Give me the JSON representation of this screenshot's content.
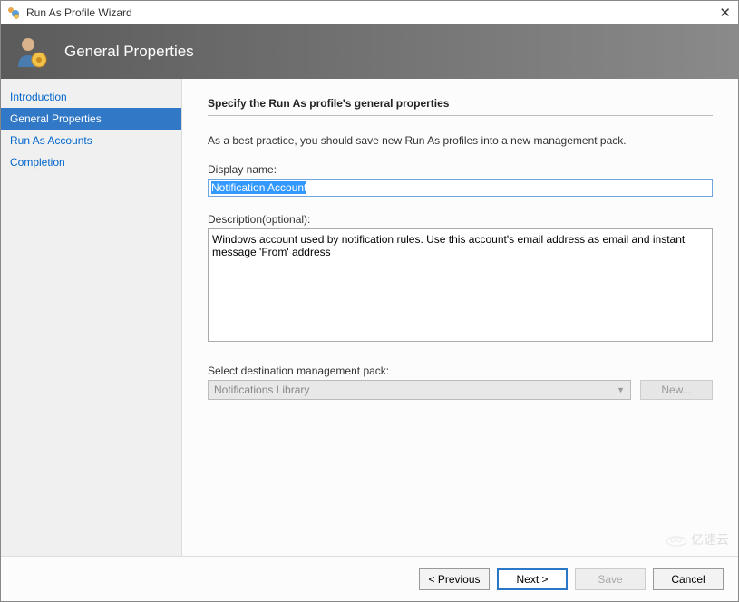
{
  "window": {
    "title": "Run As Profile Wizard"
  },
  "header": {
    "title": "General Properties"
  },
  "sidebar": {
    "items": [
      {
        "label": "Introduction",
        "active": false
      },
      {
        "label": "General Properties",
        "active": true
      },
      {
        "label": "Run As Accounts",
        "active": false
      },
      {
        "label": "Completion",
        "active": false
      }
    ]
  },
  "content": {
    "heading": "Specify the Run As profile's general properties",
    "hint": "As a best practice, you should save new Run As profiles into a new management pack.",
    "display_name_label": "Display name:",
    "display_name_value": "Notification Account",
    "description_label": "Description(optional):",
    "description_value": "Windows account used by notification rules. Use this account's email address as email and instant message 'From' address",
    "mgmt_pack_label": "Select destination management pack:",
    "mgmt_pack_value": "Notifications Library",
    "new_button": "New..."
  },
  "footer": {
    "previous": "< Previous",
    "next": "Next >",
    "save": "Save",
    "cancel": "Cancel"
  },
  "watermark": "亿速云"
}
